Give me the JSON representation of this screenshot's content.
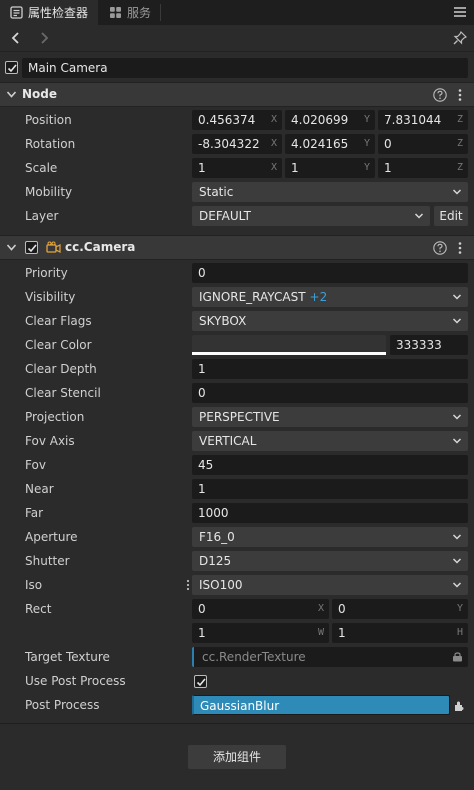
{
  "tabs": {
    "inspector": "属性检查器",
    "service": "服务"
  },
  "node_name": "Main Camera",
  "node_section": {
    "title": "Node",
    "position": {
      "label": "Position",
      "x": "0.456374",
      "y": "4.020699",
      "z": "7.831044"
    },
    "rotation": {
      "label": "Rotation",
      "x": "-8.304322",
      "y": "4.024165",
      "z": "0"
    },
    "scale": {
      "label": "Scale",
      "x": "1",
      "y": "1",
      "z": "1"
    },
    "mobility": {
      "label": "Mobility",
      "value": "Static"
    },
    "layer": {
      "label": "Layer",
      "value": "DEFAULT",
      "edit": "Edit"
    }
  },
  "axis": {
    "x": "X",
    "y": "Y",
    "z": "Z",
    "w": "W",
    "h": "H"
  },
  "camera_section": {
    "title": "cc.Camera",
    "priority": {
      "label": "Priority",
      "value": "0"
    },
    "visibility": {
      "label": "Visibility",
      "value": "IGNORE_RAYCAST",
      "extra": "+2"
    },
    "clear_flags": {
      "label": "Clear Flags",
      "value": "SKYBOX"
    },
    "clear_color": {
      "label": "Clear Color",
      "hex": "333333",
      "swatch": "#333333"
    },
    "clear_depth": {
      "label": "Clear Depth",
      "value": "1"
    },
    "clear_stencil": {
      "label": "Clear Stencil",
      "value": "0"
    },
    "projection": {
      "label": "Projection",
      "value": "PERSPECTIVE"
    },
    "fov_axis": {
      "label": "Fov Axis",
      "value": "VERTICAL"
    },
    "fov": {
      "label": "Fov",
      "value": "45"
    },
    "near": {
      "label": "Near",
      "value": "1"
    },
    "far": {
      "label": "Far",
      "value": "1000"
    },
    "aperture": {
      "label": "Aperture",
      "value": "F16_0"
    },
    "shutter": {
      "label": "Shutter",
      "value": "D125"
    },
    "iso": {
      "label": "Iso",
      "value": "ISO100"
    },
    "rect": {
      "label": "Rect",
      "x": "0",
      "y": "0",
      "w": "1",
      "h": "1"
    },
    "target_texture": {
      "label": "Target Texture",
      "placeholder": "cc.RenderTexture"
    },
    "use_post_process": {
      "label": "Use Post Process",
      "checked": true
    },
    "post_process": {
      "label": "Post Process",
      "value": "GaussianBlur"
    }
  },
  "add_component": "添加组件",
  "colors": {
    "background": "#2b2b2b",
    "header": "#383838",
    "field": "#1b1b1b",
    "select": "#3c3c3c",
    "accent": "#2e8bb8"
  },
  "icons": [
    "inspector-icon",
    "service-icon",
    "menu-icon",
    "back-icon",
    "forward-icon",
    "pin-icon",
    "help-icon",
    "more-icon",
    "camera-icon",
    "chevron-down-icon",
    "lock-icon",
    "plugin-icon"
  ]
}
